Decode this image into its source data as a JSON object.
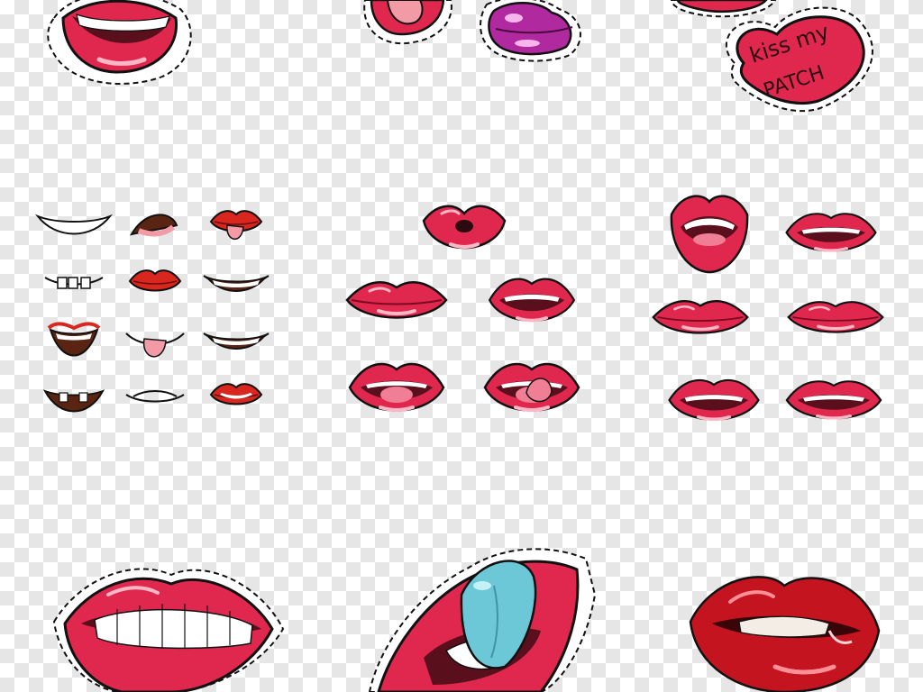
{
  "canvas": {
    "checker_light": "#ffffff",
    "checker_dark": "#e6e6e6"
  },
  "palette": {
    "lip_red": "#e0284f",
    "lip_dark": "#b3122f",
    "lip_highlight": "#ff9fb4",
    "outline": "#111111",
    "tongue_pink": "#f29aa6",
    "tongue_blue": "#6cc7d6",
    "lip_purple": "#b0299f",
    "mouth_inside": "#5a0f1c",
    "teeth": "#ffffff"
  },
  "patch": {
    "line1": "kiss my",
    "line2": "PATCH"
  },
  "icons": [
    "lips-smile-sticker-icon",
    "lips-tongue-sticker-icon",
    "purple-lips-sticker-icon",
    "heart-patch-icon",
    "cartoon-mouth-grid-icon",
    "glossy-lips-cluster-icon",
    "red-lips-grid-icon",
    "teeth-lips-sticker-icon",
    "tongue-lips-sticker-icon",
    "biting-lips-icon"
  ]
}
